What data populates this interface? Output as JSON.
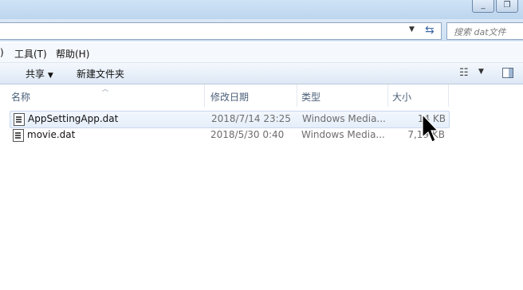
{
  "window": {
    "restore_icon": "restore-icon"
  },
  "address": {
    "search_placeholder": "搜索 dat文件"
  },
  "menu": {
    "edge_char": ")",
    "items": [
      "工具(T)",
      "帮助(H)"
    ]
  },
  "toolbar": {
    "share": "共享",
    "new_folder": "新建文件夹"
  },
  "columns": {
    "name": "名称",
    "date": "修改日期",
    "type": "类型",
    "size": "大小"
  },
  "files": [
    {
      "name": "AppSettingApp.dat",
      "date": "2018/7/14 23:25",
      "type": "Windows Media...",
      "size": "14 KB",
      "selected": true
    },
    {
      "name": "movie.dat",
      "date": "2018/5/30 0:40",
      "type": "Windows Media...",
      "size": "7,19 KB",
      "selected": false
    }
  ]
}
